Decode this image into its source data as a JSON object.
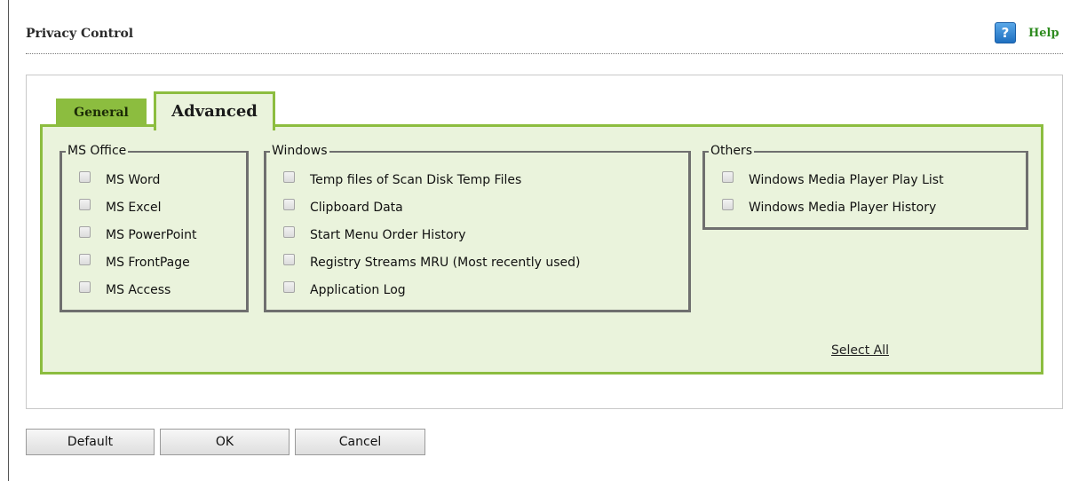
{
  "header": {
    "title": "Privacy Control",
    "help_label": "Help",
    "help_icon_glyph": "?"
  },
  "tabs": [
    {
      "label": "General",
      "active": false
    },
    {
      "label": "Advanced",
      "active": true
    }
  ],
  "groups": {
    "office": {
      "legend": "MS Office",
      "items": [
        "MS Word",
        "MS Excel",
        "MS PowerPoint",
        "MS FrontPage",
        "MS Access"
      ]
    },
    "windows": {
      "legend": "Windows",
      "items": [
        "Temp files of Scan Disk Temp Files",
        "Clipboard Data",
        "Start Menu Order History",
        "Registry Streams MRU (Most recently used)",
        "Application Log"
      ]
    },
    "others": {
      "legend": "Others",
      "items": [
        "Windows Media Player Play List",
        "Windows Media Player History"
      ]
    }
  },
  "select_all_label": "Select All",
  "buttons": {
    "default_label": "Default",
    "ok_label": "OK",
    "cancel_label": "Cancel"
  },
  "colors": {
    "accent_green": "#8cbd3f",
    "panel_bg": "#eaf3dc",
    "help_green": "#2e8b1f"
  }
}
